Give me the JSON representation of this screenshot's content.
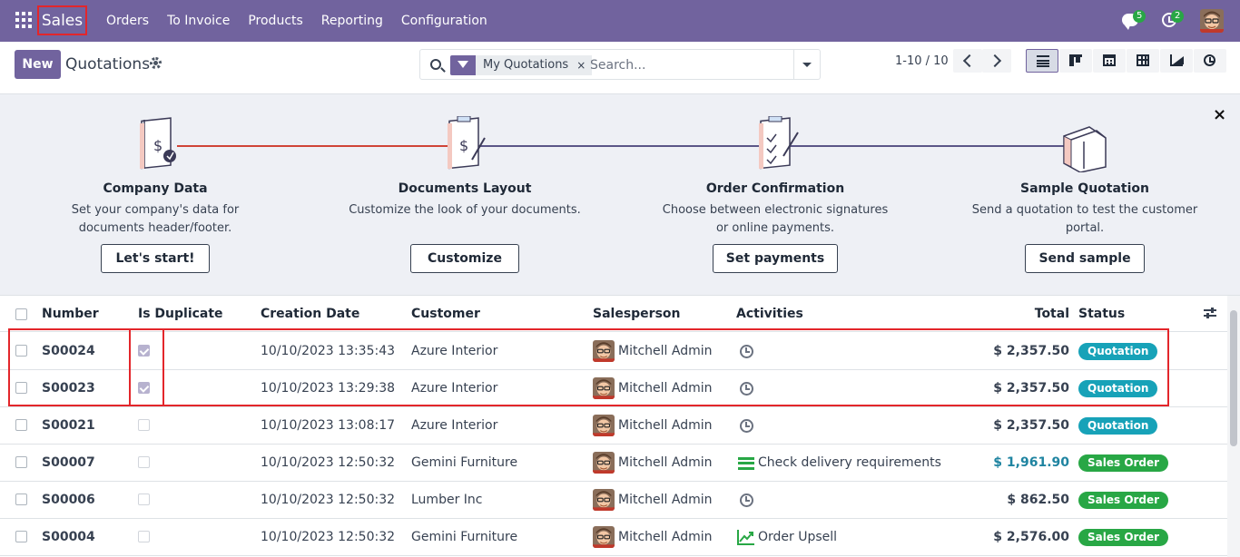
{
  "navbar": {
    "brand": "Sales",
    "menu": [
      "Orders",
      "To Invoice",
      "Products",
      "Reporting",
      "Configuration"
    ],
    "chat_count": "5",
    "activity_count": "2",
    "icons": [
      "apps-grid-icon",
      "chat-icon",
      "activity-clock-icon",
      "user-avatar"
    ]
  },
  "control": {
    "new_label": "New",
    "title": "Quotations",
    "facet_label": "My Quotations",
    "facet_close": "×",
    "search_placeholder": "Search...",
    "pager": "1-10 / 10",
    "views": [
      "list-view-icon",
      "kanban-view-icon",
      "calendar-view-icon",
      "pivot-view-icon",
      "graph-view-icon",
      "activity-view-icon"
    ]
  },
  "onboarding": {
    "close": "×",
    "steps": [
      {
        "title": "Company Data",
        "desc": "Set your company's data for documents header/footer.",
        "button": "Let's start!"
      },
      {
        "title": "Documents Layout",
        "desc": "Customize the look of your documents.",
        "button": "Customize"
      },
      {
        "title": "Order Confirmation",
        "desc": "Choose between electronic signatures or online payments.",
        "button": "Set payments"
      },
      {
        "title": "Sample Quotation",
        "desc": "Send a quotation to test the customer portal.",
        "button": "Send sample"
      }
    ],
    "colors": {
      "done": "#d04437",
      "todo": "#5b5687"
    }
  },
  "list": {
    "columns": [
      "Number",
      "Is Duplicate",
      "Creation Date",
      "Customer",
      "Salesperson",
      "Activities",
      "Total",
      "Status"
    ],
    "rows": [
      {
        "number": "S00024",
        "duplicate": true,
        "date": "10/10/2023 13:35:43",
        "customer": "Azure Interior",
        "salesperson": "Mitchell Admin",
        "activity": "",
        "activity_icon": "clock-icon",
        "total": "$ 2,357.50",
        "status": "Quotation"
      },
      {
        "number": "S00023",
        "duplicate": true,
        "date": "10/10/2023 13:29:38",
        "customer": "Azure Interior",
        "salesperson": "Mitchell Admin",
        "activity": "",
        "activity_icon": "clock-icon",
        "total": "$ 2,357.50",
        "status": "Quotation"
      },
      {
        "number": "S00021",
        "duplicate": false,
        "date": "10/10/2023 13:08:17",
        "customer": "Azure Interior",
        "salesperson": "Mitchell Admin",
        "activity": "",
        "activity_icon": "clock-icon",
        "total": "$ 2,357.50",
        "status": "Quotation"
      },
      {
        "number": "S00007",
        "duplicate": false,
        "date": "10/10/2023 12:50:32",
        "customer": "Gemini Furniture",
        "salesperson": "Mitchell Admin",
        "activity": "Check delivery requirements",
        "activity_icon": "todo-icon",
        "total": "$ 1,961.90",
        "status": "Sales Order"
      },
      {
        "number": "S00006",
        "duplicate": false,
        "date": "10/10/2023 12:50:32",
        "customer": "Lumber Inc",
        "salesperson": "Mitchell Admin",
        "activity": "",
        "activity_icon": "clock-icon",
        "total": "$ 862.50",
        "status": "Sales Order"
      },
      {
        "number": "S00004",
        "duplicate": false,
        "date": "10/10/2023 12:50:32",
        "customer": "Gemini Furniture",
        "salesperson": "Mitchell Admin",
        "activity": "Order Upsell",
        "activity_icon": "upsell-chart-icon",
        "total": "$ 2,576.00",
        "status": "Sales Order"
      }
    ],
    "status_colors": {
      "Quotation": "#17a2b8",
      "Sales Order": "#28a745"
    },
    "highlight_total_color": "#1f84a1"
  }
}
